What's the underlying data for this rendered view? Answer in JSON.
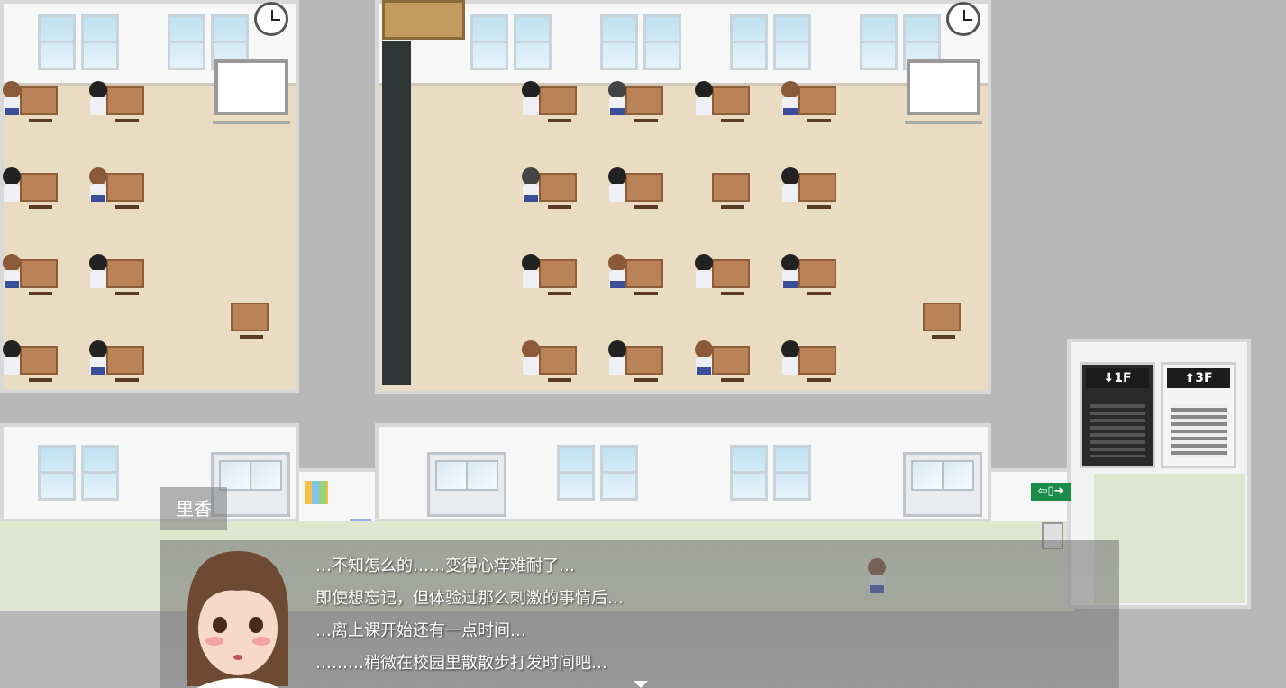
{
  "dialogue": {
    "speaker": "里香",
    "lines": [
      "…不知怎么的……变得心痒难耐了…",
      "即使想忘记，但体验过那么刺激的事情后…",
      "…离上课开始还有一点时间…",
      "………稍微在校园里散散步打发时间吧…"
    ]
  },
  "stairs": {
    "down_label": "⬇1F",
    "up_label": "⬆3F"
  },
  "exit_sign": {
    "label": "⇦▯➜"
  },
  "colors": {
    "floor": "#e9dcc2",
    "corridor": "#dfe6d0",
    "dialog_bg": "#7a7a7a",
    "exit_green": "#1a8c4a"
  }
}
